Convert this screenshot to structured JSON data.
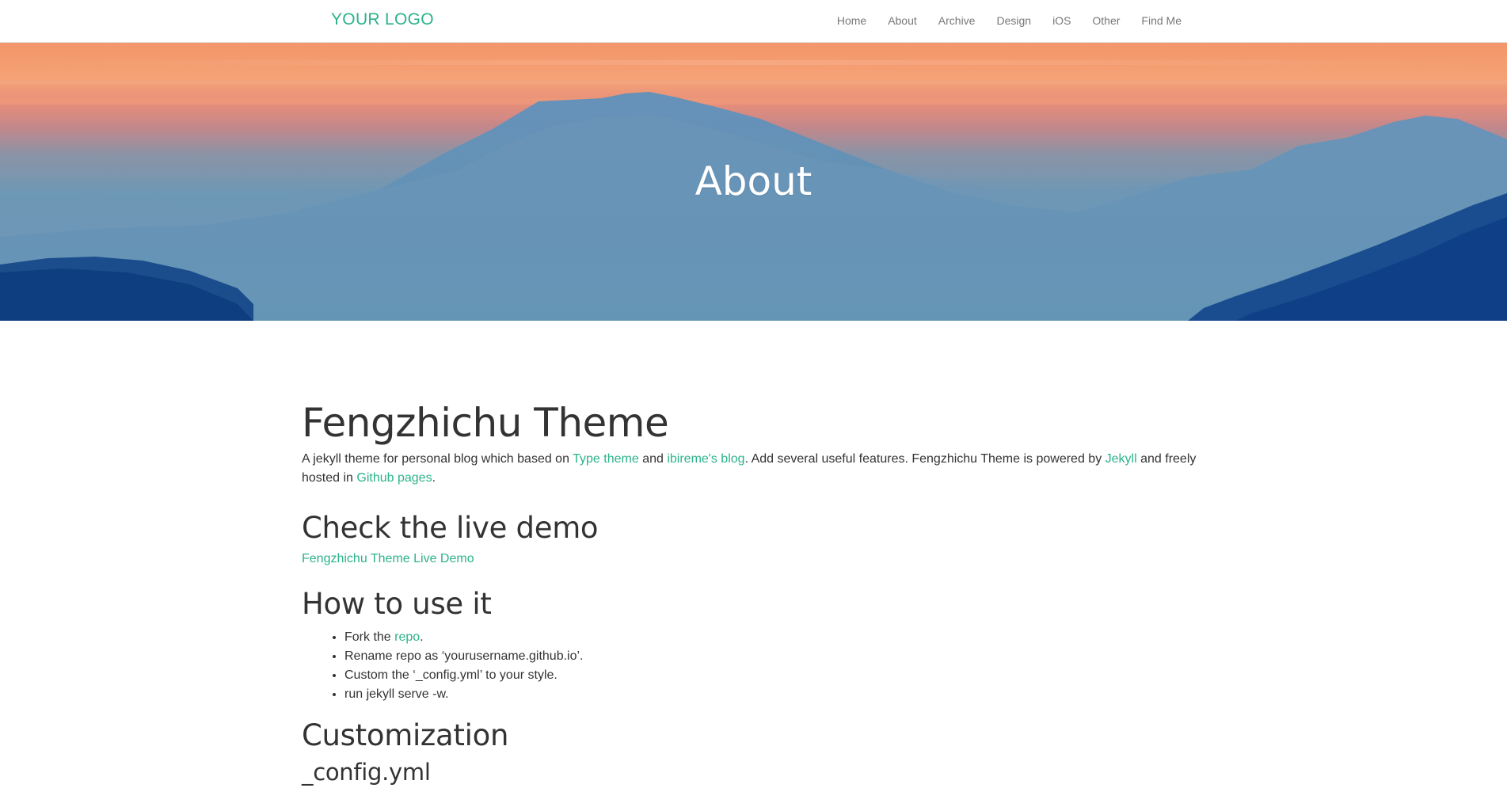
{
  "header": {
    "logo": "YOUR LOGO",
    "nav": [
      {
        "label": "Home"
      },
      {
        "label": "About"
      },
      {
        "label": "Archive"
      },
      {
        "label": "Design"
      },
      {
        "label": "iOS"
      },
      {
        "label": "Other"
      },
      {
        "label": "Find Me"
      }
    ]
  },
  "hero": {
    "title": "About"
  },
  "article": {
    "title": "Fengzhichu Theme",
    "intro": {
      "part1": "A jekyll theme for personal blog which based on ",
      "link1": "Type theme",
      "part2": " and ",
      "link2": "ibireme's blog",
      "part3": ". Add several useful features. Fengzhichu Theme is powered by ",
      "link3": "Jekyll",
      "part4": " and freely hosted in ",
      "link4": "Github pages",
      "part5": "."
    },
    "live_demo": {
      "heading": "Check the live demo",
      "link": "Fengzhichu Theme Live Demo"
    },
    "how_to": {
      "heading": "How to use it",
      "step1_text": "Fork the ",
      "step1_link": "repo",
      "step1_end": ".",
      "step2": "Rename repo as ‘yourusername.github.io’.",
      "step3": "Custom the ‘_config.yml’ to your style.",
      "step4": "run jekyll serve -w."
    },
    "customization": {
      "heading": "Customization",
      "subheading": "_config.yml"
    }
  },
  "colors": {
    "accent": "#2bb38b",
    "text": "#333333",
    "nav_text": "#777777"
  }
}
